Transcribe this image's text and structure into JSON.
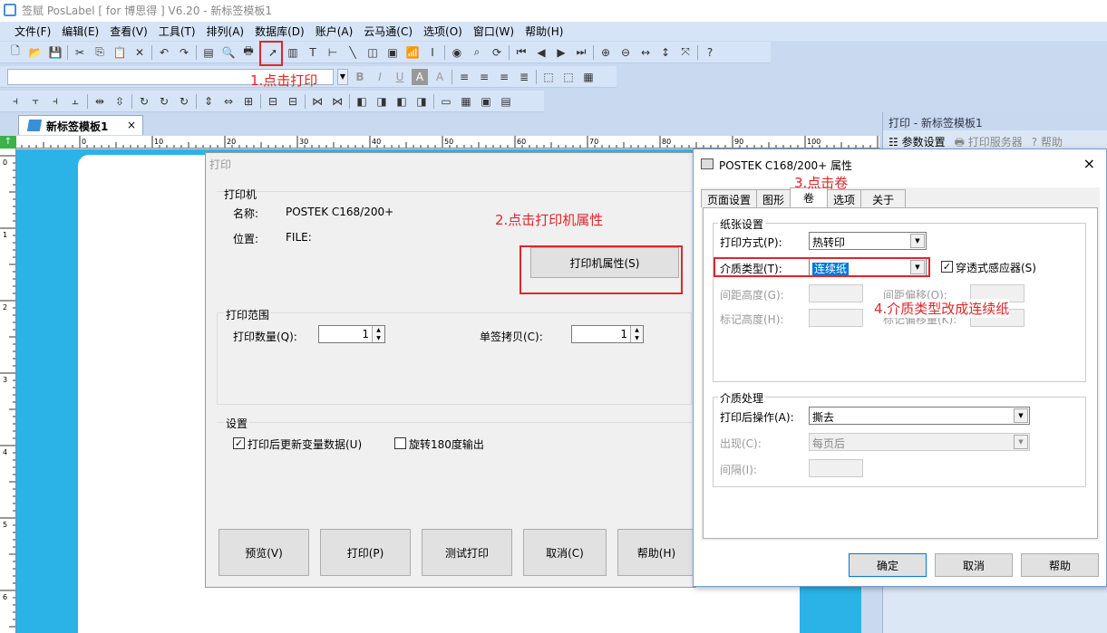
{
  "app": {
    "title": "签赋 PosLabel [ for 博思得 ]  V6.20   - 新标签模板1"
  },
  "menu": [
    "文件(F)",
    "编辑(E)",
    "查看(V)",
    "工具(T)",
    "排列(A)",
    "数据库(D)",
    "账户(A)",
    "云马通(C)",
    "选项(O)",
    "窗口(W)",
    "帮助(H)"
  ],
  "doc_tab": {
    "label": "新标签模板1",
    "close": "×"
  },
  "ruler": {
    "top": [
      "0",
      "10",
      "20",
      "30",
      "40",
      "50",
      "60",
      "70",
      "80",
      "90",
      "100"
    ],
    "left": [
      "0",
      "1",
      "2",
      "3",
      "4",
      "5",
      "6"
    ]
  },
  "side_panel": {
    "title": "打印 - 新标签模板1",
    "tabs": [
      "参数设置",
      "打印服务器",
      "帮助"
    ]
  },
  "print_dialog": {
    "title": "打印",
    "printer_group": "打印机",
    "name_label": "名称:",
    "name_value": "POSTEK C168/200+",
    "location_label": "位置:",
    "location_value": "FILE:",
    "properties_button": "打印机属性(S)",
    "range_group": "打印范围",
    "quantity_label": "打印数量(Q):",
    "quantity_value": "1",
    "copies_label": "单签拷贝(C):",
    "copies_value": "1",
    "settings_group": "设置",
    "update_vars_label": "打印后更新变量数据(U)",
    "update_vars_checked": true,
    "rotate_label": "旋转180度输出",
    "rotate_checked": false,
    "buttons": {
      "preview": "预览(V)",
      "print": "打印(P)",
      "test": "测试打印",
      "cancel": "取消(C)",
      "help": "帮助(H)"
    }
  },
  "prop_dialog": {
    "title": "POSTEK C168/200+ 属性",
    "close": "×",
    "tabs": [
      "页面设置",
      "图形",
      "卷",
      "选项",
      "关于"
    ],
    "active_tab": "卷",
    "paper_group": "纸张设置",
    "print_method_label": "打印方式(P):",
    "print_method_value": "热转印",
    "media_type_label": "介质类型(T):",
    "media_type_value": "连续纸",
    "sensor_label": "穿透式感应器(S)",
    "sensor_checked": true,
    "gap_height_label": "间距高度(G):",
    "gap_offset_label": "间距偏移(O):",
    "mark_height_label": "标记高度(H):",
    "mark_offset_label": "标记偏移量(K):",
    "media_group": "介质处理",
    "post_action_label": "打印后操作(A):",
    "post_action_value": "撕去",
    "occur_label": "出现(C):",
    "occur_value": "每页后",
    "interval_label": "间隔(I):",
    "buttons": {
      "ok": "确定",
      "cancel": "取消",
      "help": "帮助"
    }
  },
  "annotations": {
    "step1": "1.点击打印",
    "step2": "2.点击打印机属性",
    "step3": "3.点击卷",
    "step4": "4.介质类型改成连续纸"
  }
}
